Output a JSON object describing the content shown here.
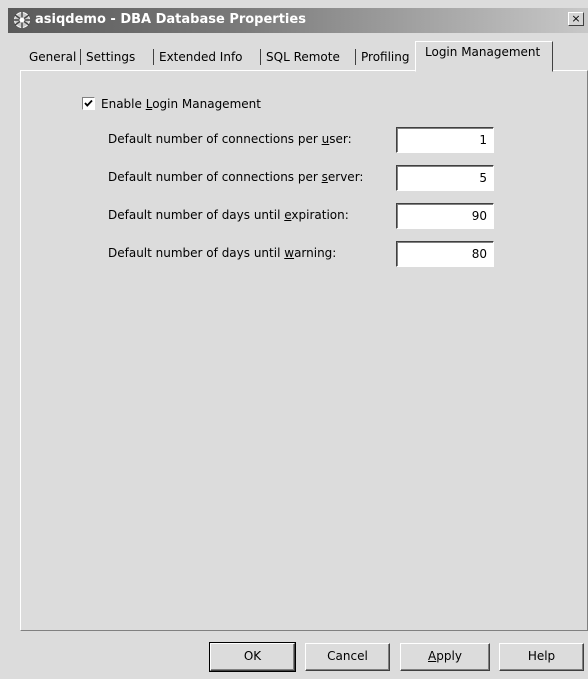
{
  "window": {
    "title": "asiqdemo - DBA Database Properties",
    "close_label": "×"
  },
  "tabs": [
    {
      "label": "General"
    },
    {
      "label": "Settings"
    },
    {
      "label": "Extended Info"
    },
    {
      "label": "SQL Remote"
    },
    {
      "label": "Profiling"
    },
    {
      "label": "Login Management",
      "active": true
    }
  ],
  "login": {
    "enable_label_pre": "Enable ",
    "enable_label_ul": "L",
    "enable_label_post": "ogin Management",
    "enabled": true,
    "fields": [
      {
        "pre": "Default number of connections per ",
        "ul": "u",
        "post": "ser:",
        "value": "1"
      },
      {
        "pre": "Default number of connections per ",
        "ul": "s",
        "post": "erver:",
        "value": "5"
      },
      {
        "pre": "Default number of days until ",
        "ul": "e",
        "post": "xpiration:",
        "value": "90"
      },
      {
        "pre": "Default number of days until ",
        "ul": "w",
        "post": "arning:",
        "value": "80"
      }
    ]
  },
  "buttons": {
    "ok": "OK",
    "cancel": "Cancel",
    "apply_ul": "A",
    "apply_rest": "pply",
    "help": "Help"
  }
}
